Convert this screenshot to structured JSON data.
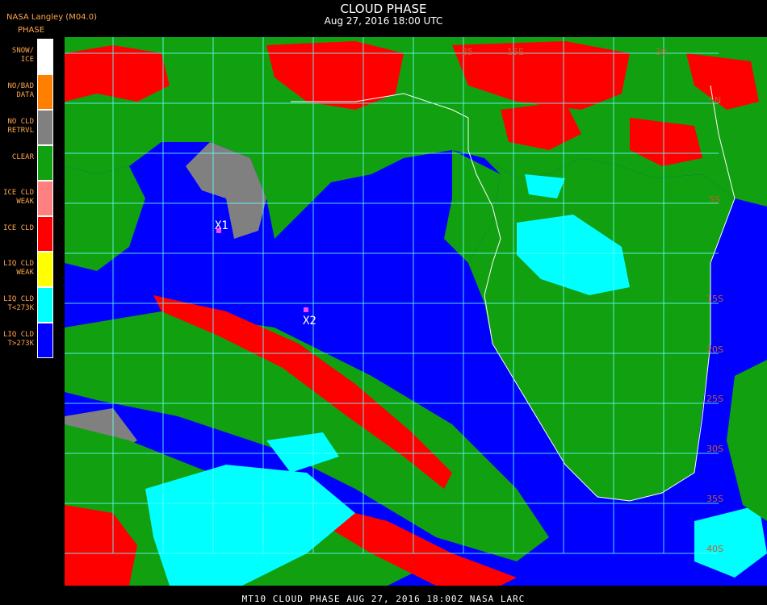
{
  "header": {
    "org": "NASA Langley (M04.0)",
    "legend_title": "PHASE",
    "title": "CLOUD PHASE",
    "subtitle": "Aug 27, 2016 18:00 UTC"
  },
  "legend": [
    {
      "label": "SNOW/\nICE",
      "color": "#ffffff"
    },
    {
      "label": "NO/BAD\nDATA",
      "color": "#ff8000"
    },
    {
      "label": "NO CLD\nRETRVL",
      "color": "#808080"
    },
    {
      "label": "CLEAR",
      "color": "#10a010"
    },
    {
      "label": "ICE CLD\nWEAK",
      "color": "#ff8080"
    },
    {
      "label": "ICE CLD",
      "color": "#ff0000"
    },
    {
      "label": "LIQ CLD\nWEAK",
      "color": "#ffff00"
    },
    {
      "label": "LIQ CLD\nT<273K",
      "color": "#00ffff"
    },
    {
      "label": "LIQ CLD\nT>273K",
      "color": "#0000ff"
    }
  ],
  "map": {
    "markers": [
      {
        "label": "X1",
        "color": "#ff40ff"
      },
      {
        "label": "X2",
        "color": "#ff40ff"
      }
    ],
    "lat_labels": [
      "5N",
      "5S",
      "15S",
      "20S",
      "25S",
      "30S",
      "35S",
      "40S"
    ],
    "lon_labels": [
      "15E",
      "25",
      "30"
    ],
    "colors": {
      "water": "#0000ff",
      "land": "#10a010",
      "ice": "#ff0000",
      "liquid_cold": "#00ffff",
      "no_retrieval": "#808080",
      "snow": "#ffffff",
      "grid": "#66ffff",
      "coast": "#ffffff",
      "grid_label": "#c06030"
    }
  },
  "footer": {
    "text": "MT10  CLOUD PHASE   AUG 27, 2016 18:00Z   NASA LARC"
  }
}
